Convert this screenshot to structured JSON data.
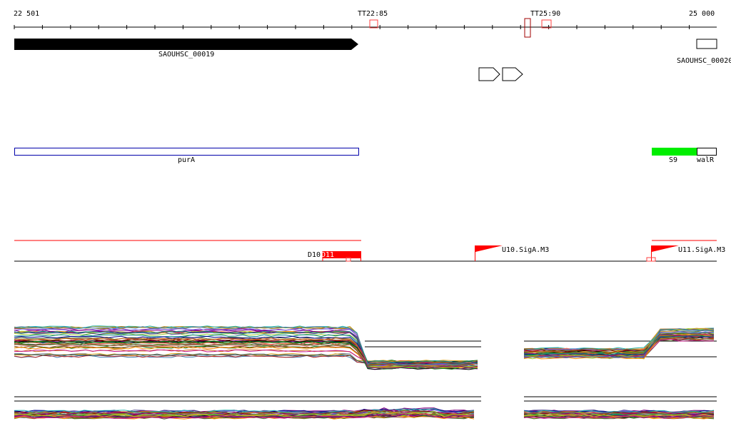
{
  "ruler": {
    "start_label": "22 501",
    "end_label": "25 000",
    "terminators": [
      {
        "label": "TT22:85"
      },
      {
        "label": "TT25:90"
      }
    ]
  },
  "genes": {
    "left_label": "SAOUHSC_00019",
    "right_label": "SAOUHSC_00020"
  },
  "annotations": {
    "left_label": "purA",
    "right_labels": [
      "S9",
      "walR"
    ],
    "colors": {
      "outline": "#0000aa",
      "green": "#00ee00"
    }
  },
  "promoters": {
    "left_label": "D10",
    "left_label_overlap": "D11",
    "mid_label": "U10.SigA.M3",
    "right_label": "U11.SigA.M3",
    "colors": {
      "flag": "#ff0000",
      "line": "#ff0000"
    }
  },
  "colors": {
    "terminator": "#ff4040",
    "gene_fill": "#000000"
  }
}
